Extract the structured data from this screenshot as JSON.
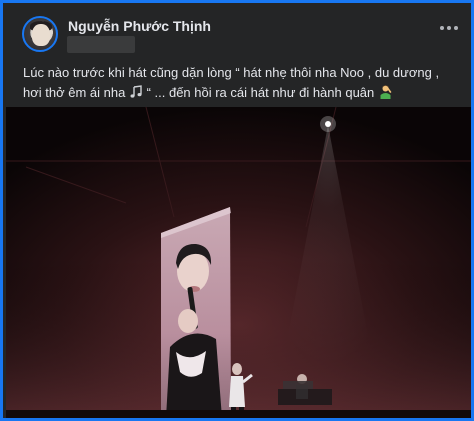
{
  "post": {
    "author": "Nguyễn Phước Thịnh",
    "text_line1": "Lúc nào trước khi hát cũng dặn lòng “ hát nhẹ thôi nha Noo , du dương ,",
    "text_line2_a": "hơi thở êm ái nha",
    "text_line2_b": "“ ... đến hồi ra cái hát như đi hành quân"
  },
  "icons": {
    "more": "more-horizontal-icon",
    "music": "music-note-emoji-icon",
    "salute": "saluting-person-emoji-icon"
  },
  "colors": {
    "frame_border": "#1877f2",
    "card_background": "#242526",
    "text_primary": "#e4e6eb"
  }
}
